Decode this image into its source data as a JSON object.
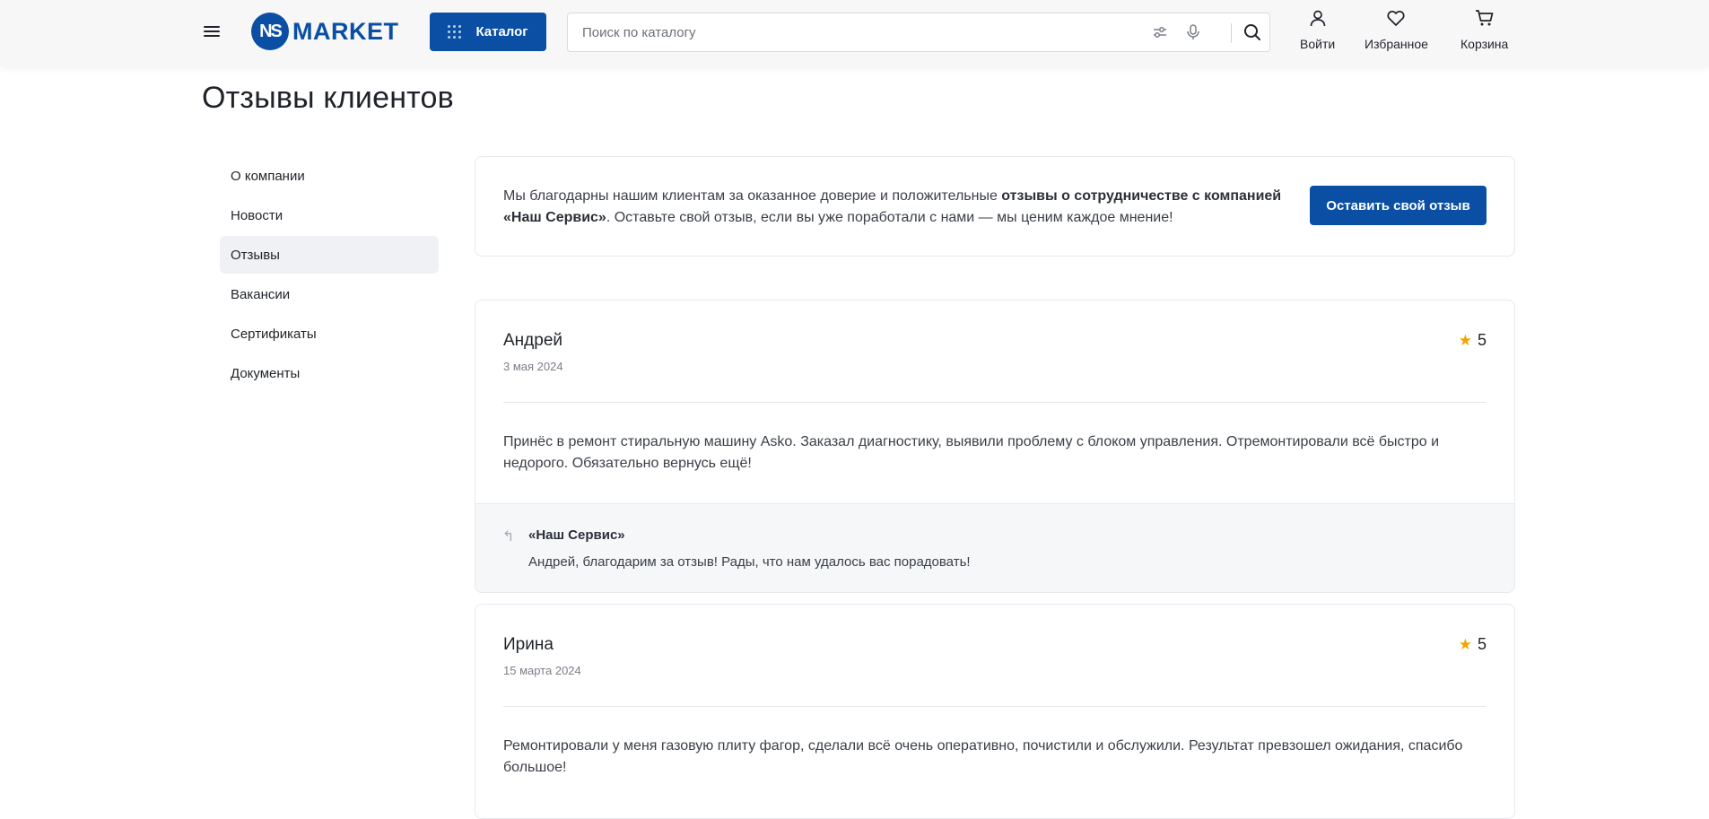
{
  "header": {
    "logo_mark": "NS",
    "logo_text": "MARKET",
    "catalog_label": "Каталог",
    "search_placeholder": "Поиск по каталогу",
    "actions": [
      {
        "label": "Войти",
        "icon": "user-icon"
      },
      {
        "label": "Избранное",
        "icon": "heart-icon"
      },
      {
        "label": "Корзина",
        "icon": "cart-icon"
      }
    ]
  },
  "page": {
    "title": "Отзывы клиентов"
  },
  "sidebar": {
    "items": [
      {
        "label": "О компании"
      },
      {
        "label": "Новости"
      },
      {
        "label": "Отзывы",
        "active": true
      },
      {
        "label": "Вакансии"
      },
      {
        "label": "Сертификаты"
      },
      {
        "label": "Документы"
      }
    ]
  },
  "intro": {
    "text_before": "Мы благодарны нашим клиентам за оказанное доверие и положительные ",
    "text_bold": "отзывы о сотрудничестве с компанией «Наш Сервис»",
    "text_after": ". Оставьте свой отзыв, если вы уже поработали с нами — мы ценим каждое мнение!",
    "button_label": "Оставить свой отзыв"
  },
  "reviews": [
    {
      "name": "Андрей",
      "date": "3 мая 2024",
      "rating": "5",
      "text": "Принёс в ремонт стиральную машину Asko. Заказал диагностику, выявили проблему с блоком управления. Отремонтировали всё быстро и недорого. Обязательно вернусь ещё!",
      "reply": {
        "author": "«Наш Сервис»",
        "text": "Андрей, благодарим за отзыв! Рады, что нам удалось вас порадовать!"
      }
    },
    {
      "name": "Ирина",
      "date": "15 марта 2024",
      "rating": "5",
      "text": "Ремонтировали у меня газовую плиту фагор, сделали всё очень оперативно, почистили и обслужили. Результат превзошел ожидания, спасибо большое!"
    }
  ],
  "colors": {
    "brand": "#0a4fa3",
    "star": "#f0a500"
  }
}
